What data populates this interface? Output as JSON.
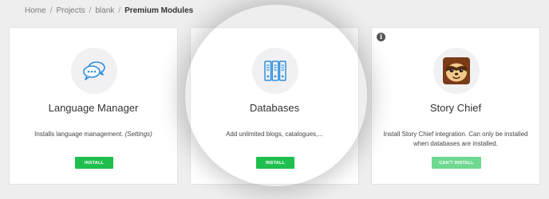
{
  "breadcrumb": {
    "items": [
      "Home",
      "Projects",
      "blank"
    ],
    "separator": "/",
    "current": "Premium Modules"
  },
  "modules": [
    {
      "icon": "chat-bubbles-icon",
      "title": "Language Manager",
      "description": "Installs language management.",
      "description_link": "(Settings)",
      "button": "INSTALL",
      "button_enabled": true
    },
    {
      "icon": "database-icon",
      "title": "Databases",
      "description": "Add unlimited blogs, catalogues,...",
      "description_link": "",
      "button": "INSTALL",
      "button_enabled": true
    },
    {
      "icon": "sloth-logo-icon",
      "title": "Story Chief",
      "description": "Install Story Chief integration. Can only be installed when databases are installed.",
      "description_link": "",
      "button": "CAN'T INSTALL",
      "button_enabled": false,
      "info_badge": "i"
    }
  ],
  "colors": {
    "background": "#eeeeee",
    "card": "#ffffff",
    "accent_blue": "#2f8fe0",
    "button_green": "#1fbf4d",
    "button_disabled": "#6ed991"
  }
}
